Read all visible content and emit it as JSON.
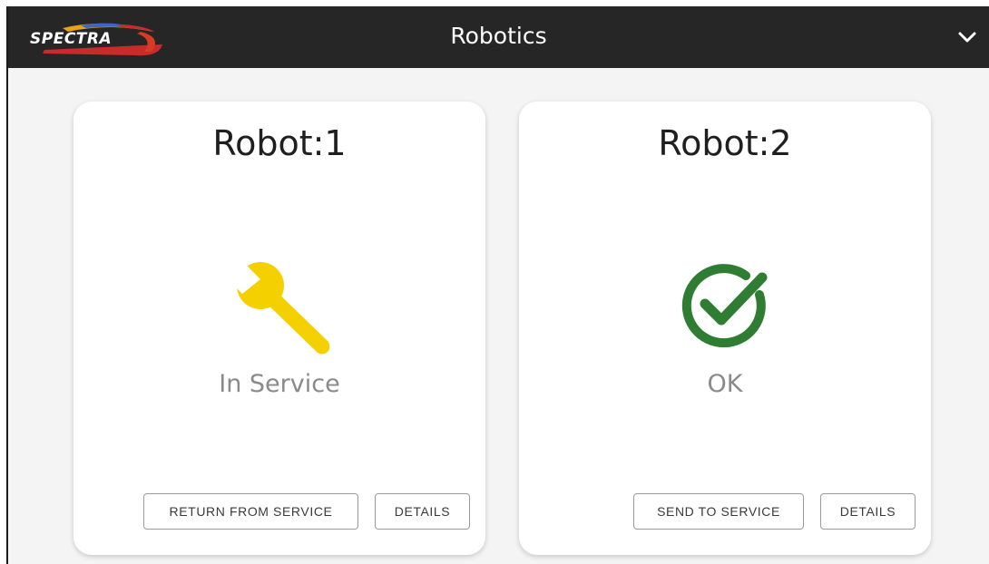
{
  "header": {
    "logo_text": "SPECTRA",
    "title": "Robotics",
    "menu_icon": "chevron-down-icon"
  },
  "robots": [
    {
      "name": "Robot:1",
      "status": "In Service",
      "status_icon": "wrench-icon",
      "status_color": "#f5d000",
      "primary_action": "RETURN FROM SERVICE",
      "details_action": "DETAILS"
    },
    {
      "name": "Robot:2",
      "status": "OK",
      "status_icon": "check-circle-icon",
      "status_color": "#2e7d32",
      "primary_action": "SEND TO SERVICE",
      "details_action": "DETAILS"
    }
  ],
  "colors": {
    "topbar": "#262626",
    "background": "#f4f4f4",
    "card": "#ffffff",
    "status_text": "#8a8a8a"
  }
}
